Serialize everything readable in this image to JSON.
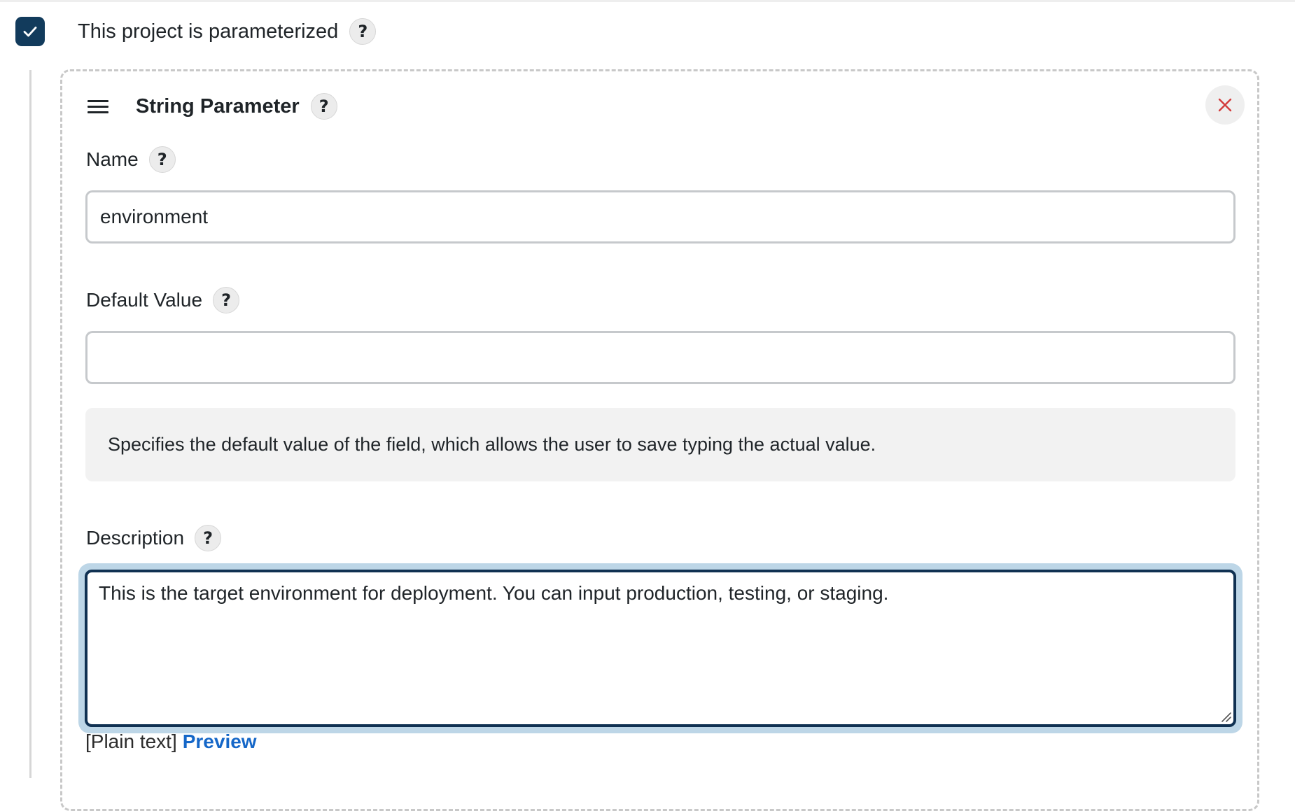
{
  "parameterized": {
    "checked": true,
    "label": "This project is parameterized",
    "help": "?"
  },
  "parameter": {
    "type_title": "String Parameter",
    "help": "?",
    "name": {
      "label": "Name",
      "help": "?",
      "value": "environment"
    },
    "default_value": {
      "label": "Default Value",
      "help": "?",
      "value": "",
      "help_text": "Specifies the default value of the field, which allows the user to save typing the actual value."
    },
    "description": {
      "label": "Description",
      "help": "?",
      "value": "This is the target environment for deployment. You can input production, testing, or staging."
    },
    "format": {
      "plain_text": "[Plain text]",
      "preview": "Preview"
    }
  },
  "colors": {
    "checkbox": "#123b5c",
    "focus_ring": "#bdd6e7",
    "focus_border": "#103152",
    "link": "#1567c8",
    "close_icon": "#d33a3a"
  },
  "icons": {
    "checkbox": "check-icon",
    "drag": "drag-handle-icon",
    "close": "close-icon"
  }
}
